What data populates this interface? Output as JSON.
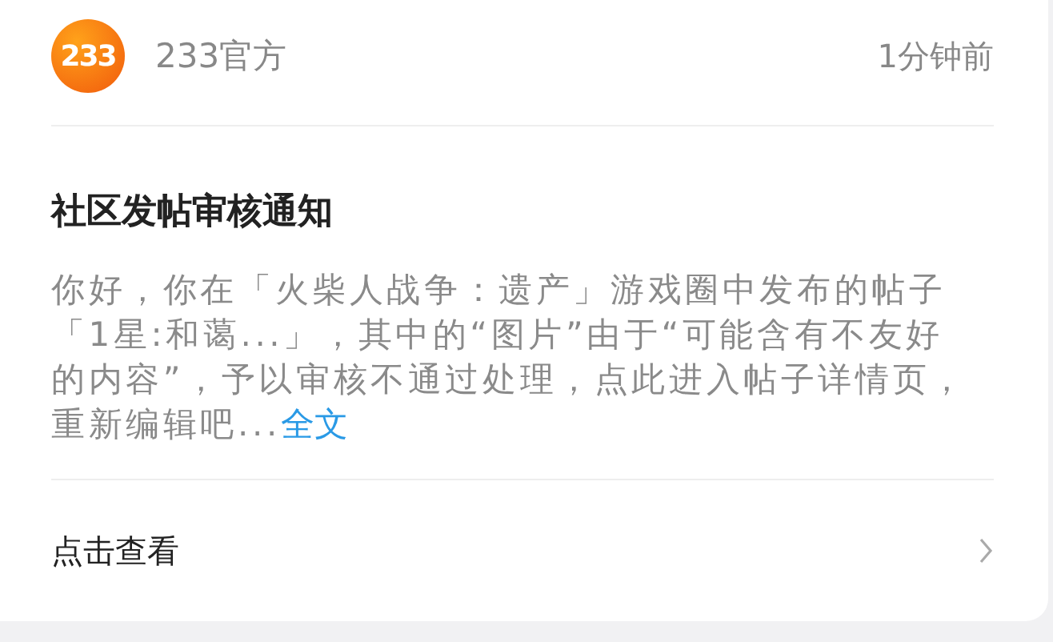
{
  "header": {
    "logo_text": "233",
    "sender": "233官方",
    "time": "1分钟前"
  },
  "notice": {
    "title": "社区发帖审核通知",
    "body": "你好，你在「火柴人战争：遗产」游戏圈中发布的帖子「1星:和蔼...」，其中的“图片”由于“可能含有不友好的内容”，予以审核不通过处理，点此进入帖子详情页，重新编辑吧...",
    "more_link": "全文"
  },
  "footer": {
    "action": "点击查看"
  }
}
